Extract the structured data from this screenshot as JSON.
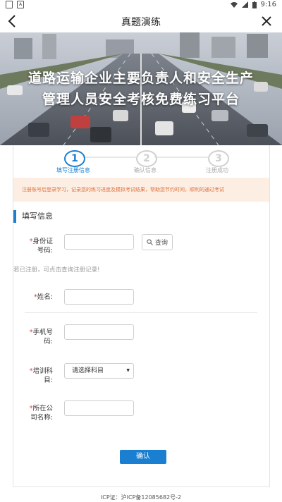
{
  "statusbar": {
    "left_icons": [
      "gallery-icon",
      "a-icon"
    ],
    "time": "9:16"
  },
  "header": {
    "title": "真题演练"
  },
  "banner": {
    "line1": "道路运输企业主要负责人和安全生产",
    "line2": "管理人员安全考核免费练习平台"
  },
  "steps": [
    {
      "number": "1",
      "label": "填写注册信息",
      "active": true
    },
    {
      "number": "2",
      "label": "确认信息",
      "active": false
    },
    {
      "number": "3",
      "label": "注册成功",
      "active": false
    }
  ],
  "notice": "注册账号后登录学习，记录您的练习进度及模拟考试结果，帮助您节约时间，顺利的通过考试",
  "section_title": "填写信息",
  "form": {
    "id_label_1": "身份证",
    "id_label_2": "号码:",
    "query_button": "查询",
    "hint": "若已注册，可点击查询注册记录!",
    "name_label": "姓名:",
    "phone_label_1": "手机号",
    "phone_label_2": "码:",
    "course_label_1": "培训科",
    "course_label_2": "目:",
    "course_placeholder": "请选择科目",
    "company_label_1": "所在公",
    "company_label_2": "司名称:",
    "required_mark": "*",
    "confirm_button": "确认"
  },
  "footer": {
    "icp": "ICP证：沪ICP备12085682号-2"
  },
  "colors": {
    "accent": "#1a7fd1",
    "notice_bg": "#fdeee4",
    "notice_text": "#e0713a",
    "required": "#e03c3c"
  }
}
